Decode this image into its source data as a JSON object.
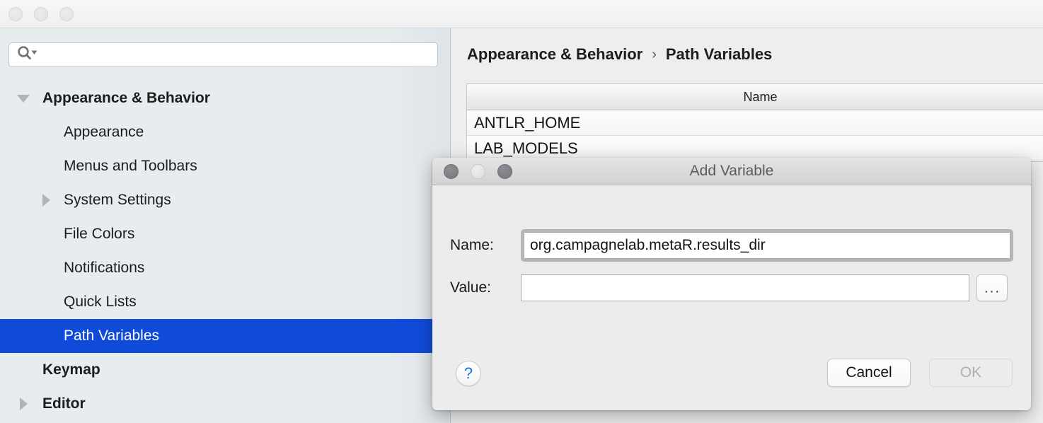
{
  "window": {
    "traffic_lights": [
      "close",
      "minimize",
      "zoom"
    ]
  },
  "search": {
    "value": "",
    "placeholder": "",
    "icon": "search-icon"
  },
  "sidebar": {
    "items": [
      {
        "label": "Appearance & Behavior",
        "level": 0,
        "twisty": "down",
        "bold": true,
        "selected": false
      },
      {
        "label": "Appearance",
        "level": 1,
        "twisty": "none",
        "bold": false,
        "selected": false
      },
      {
        "label": "Menus and Toolbars",
        "level": 1,
        "twisty": "none",
        "bold": false,
        "selected": false
      },
      {
        "label": "System Settings",
        "level": 1,
        "twisty": "right",
        "bold": false,
        "selected": false
      },
      {
        "label": "File Colors",
        "level": 1,
        "twisty": "none",
        "bold": false,
        "selected": false
      },
      {
        "label": "Notifications",
        "level": 1,
        "twisty": "none",
        "bold": false,
        "selected": false
      },
      {
        "label": "Quick Lists",
        "level": 1,
        "twisty": "none",
        "bold": false,
        "selected": false
      },
      {
        "label": "Path Variables",
        "level": 1,
        "twisty": "none",
        "bold": false,
        "selected": true
      },
      {
        "label": "Keymap",
        "level": 0,
        "twisty": "none",
        "bold": true,
        "selected": false
      },
      {
        "label": "Editor",
        "level": 0,
        "twisty": "right",
        "bold": true,
        "selected": false
      }
    ],
    "selection_color": "#0f4bd8"
  },
  "content": {
    "breadcrumb": {
      "parent": "Appearance & Behavior",
      "separator": "›",
      "current": "Path Variables"
    },
    "table": {
      "columns": [
        "Name"
      ],
      "rows": [
        {
          "name": "ANTLR_HOME"
        },
        {
          "name": "LAB_MODELS"
        }
      ]
    },
    "copy_icon": "copy-icon"
  },
  "dialog": {
    "title": "Add Variable",
    "traffic_lights": [
      "close",
      "minimize",
      "zoom"
    ],
    "fields": [
      {
        "label": "Name:",
        "value": "org.campagnelab.metaR.results_dir",
        "placeholder": "",
        "focused": true
      },
      {
        "label": "Value:",
        "value": "",
        "placeholder": "",
        "focused": false
      }
    ],
    "browse_label": "···",
    "help_label": "?",
    "buttons": [
      {
        "label": "Cancel",
        "state": "enabled"
      },
      {
        "label": "OK",
        "state": "disabled"
      }
    ]
  }
}
